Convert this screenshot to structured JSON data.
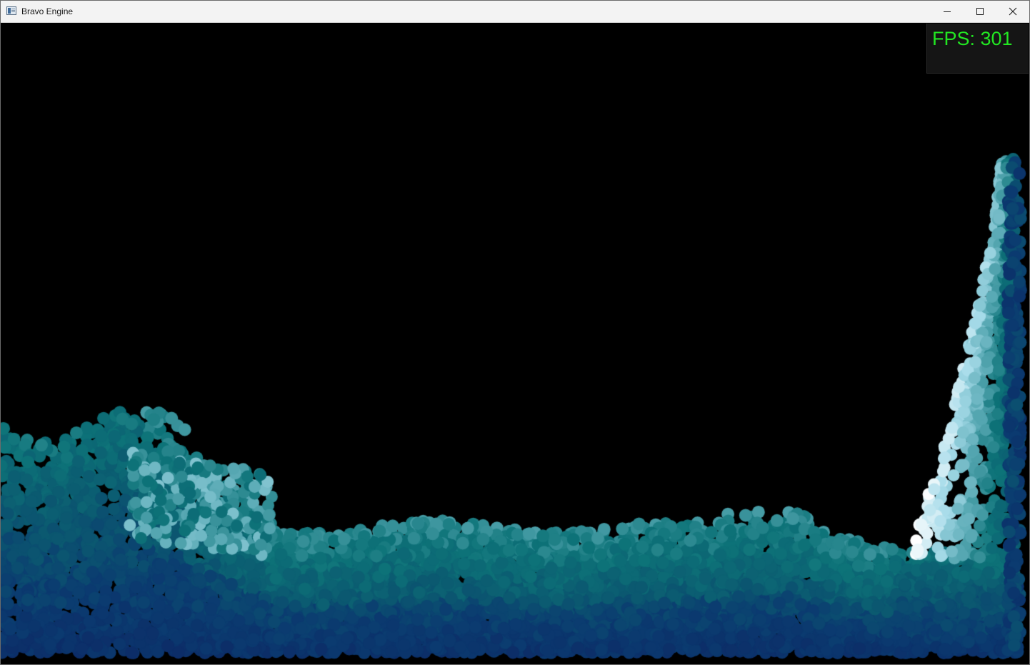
{
  "window": {
    "title": "Bravo Engine",
    "controls": {
      "minimize": "minimize-icon",
      "maximize": "maximize-icon",
      "close": "close-icon"
    }
  },
  "overlay": {
    "fps_text": "FPS: 301",
    "fps_color": "#22e622"
  },
  "scene": {
    "background_color": "#000000",
    "particle_palette": [
      "#0c2a66",
      "#0b3b70",
      "#0b5870",
      "#0d7378",
      "#5aaab5",
      "#a8dcea",
      "#ffffff"
    ]
  }
}
